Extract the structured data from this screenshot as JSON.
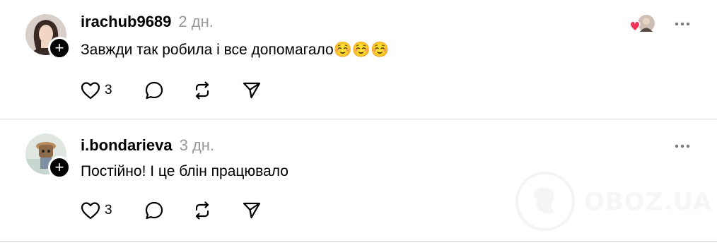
{
  "posts": [
    {
      "username": "irachub9689",
      "time": "2 дн.",
      "text": "Завжди так робила і все допомагало",
      "emojis": "☺️☺️☺️",
      "likes": "3",
      "has_liked_by": true
    },
    {
      "username": "i.bondarieva",
      "time": "3 дн.",
      "text": "Постійно! І це блін працювало",
      "emojis": "",
      "likes": "3",
      "has_liked_by": false
    }
  ],
  "colors": {
    "heart_red": "#ee3355",
    "muted_gray": "#999999"
  },
  "watermark": {
    "text": "OBOZ.UA"
  }
}
